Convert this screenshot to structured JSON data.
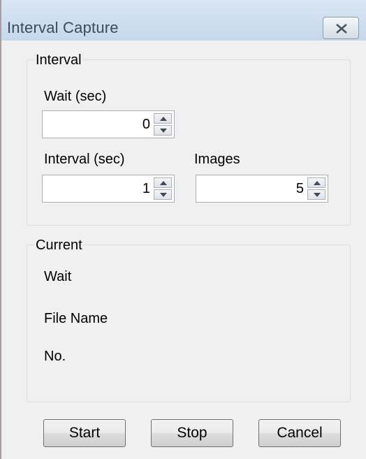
{
  "window": {
    "title": "Interval Capture"
  },
  "interval_group": {
    "title": "Interval",
    "wait_label": "Wait (sec)",
    "wait_value": "0",
    "interval_label": "Interval (sec)",
    "interval_value": "1",
    "images_label": "Images",
    "images_value": "5"
  },
  "current_group": {
    "title": "Current",
    "wait_label": "Wait",
    "file_name_label": "File Name",
    "no_label": "No."
  },
  "buttons": {
    "start": "Start",
    "stop": "Stop",
    "cancel": "Cancel"
  },
  "icons": {
    "close": "close-icon",
    "spin_up": "chevron-up-icon",
    "spin_down": "chevron-down-icon"
  }
}
